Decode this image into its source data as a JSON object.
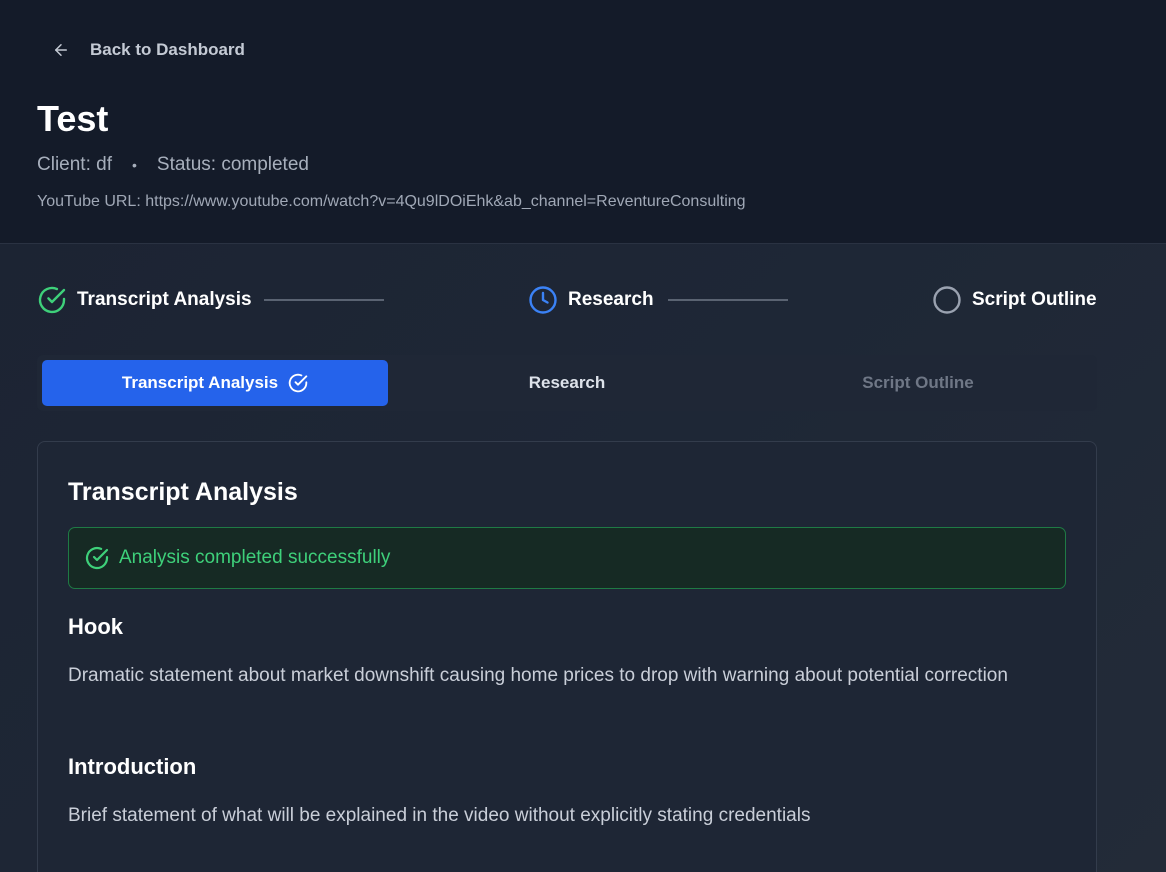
{
  "nav": {
    "back_label": "Back to Dashboard"
  },
  "project": {
    "title": "Test",
    "client": "Client: df",
    "separator": "•",
    "status": "Status: completed",
    "youtube_url": "YouTube URL: https://www.youtube.com/watch?v=4Qu9lDOiEhk&ab_channel=ReventureConsulting"
  },
  "stepper": {
    "steps": [
      {
        "label": "Transcript Analysis",
        "state": "completed",
        "icon": "check-circle-icon"
      },
      {
        "label": "Research",
        "state": "in-progress",
        "icon": "clock-icon"
      },
      {
        "label": "Script Outline",
        "state": "pending",
        "icon": "empty-circle-icon"
      }
    ]
  },
  "tabs": [
    {
      "label": "Transcript Analysis",
      "state": "active",
      "icon": "check-circle-icon"
    },
    {
      "label": "Research",
      "state": "enabled"
    },
    {
      "label": "Script Outline",
      "state": "disabled"
    }
  ],
  "card": {
    "title": "Transcript Analysis",
    "alert": "Analysis completed successfully",
    "sections": [
      {
        "heading": "Hook",
        "text": "Dramatic statement about market downshift causing home prices to drop with warning about potential correction"
      },
      {
        "heading": "Introduction",
        "text": "Brief statement of what will be explained in the video without explicitly stating credentials"
      }
    ]
  },
  "colors": {
    "accent": "#2563eb",
    "success": "#3ed07a",
    "clock": "#3b82f6",
    "header_bg": "#141b29"
  }
}
